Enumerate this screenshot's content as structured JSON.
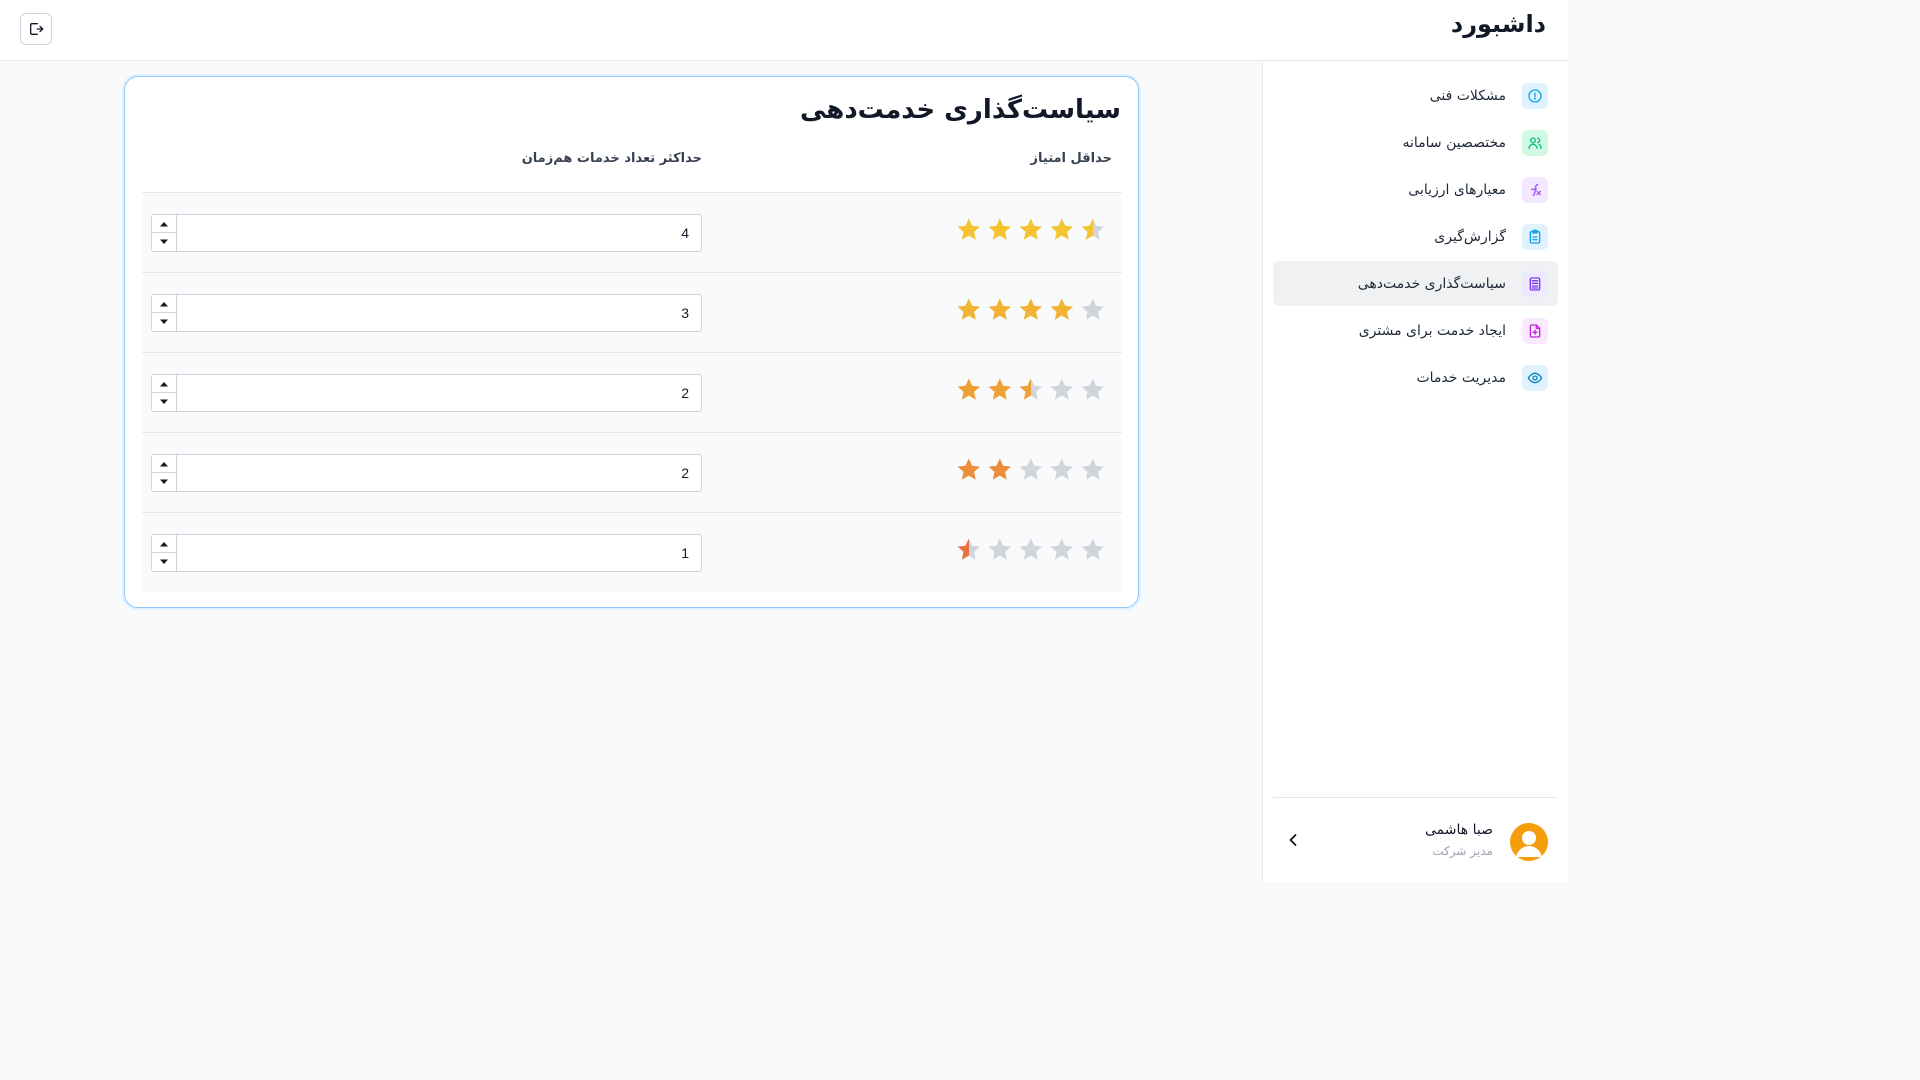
{
  "header": {
    "brand": "داشبورد",
    "logout_icon": "logout-icon"
  },
  "sidebar": {
    "items": [
      {
        "label": "مشکلات فنی",
        "icon": "alert-circle-icon",
        "color": "#0ea5e9",
        "bg": "#e0f2fe",
        "active": false
      },
      {
        "label": "مختصصین سامانه",
        "icon": "users-icon",
        "color": "#10b981",
        "bg": "#d1fae5",
        "active": false
      },
      {
        "label": "معیارهای ارزیابی",
        "icon": "function-icon",
        "color": "#a855f7",
        "bg": "#f3e8ff",
        "active": false
      },
      {
        "label": "گزارش‌گیری",
        "icon": "clipboard-icon",
        "color": "#0ea5e9",
        "bg": "#e0f2fe",
        "active": false
      },
      {
        "label": "سیاست‌گذاری خدمت‌دهی",
        "icon": "calculator-icon",
        "color": "#7c3aed",
        "bg": "#ede9fe",
        "active": true
      },
      {
        "label": "ایجاد خدمت برای مشتری",
        "icon": "file-plus-icon",
        "color": "#c026d3",
        "bg": "#fae8ff",
        "active": false
      },
      {
        "label": "مدیریت خدمات",
        "icon": "eye-icon",
        "color": "#0284c7",
        "bg": "#e0f2fe",
        "active": false
      }
    ],
    "user": {
      "name": "صبا هاشمی",
      "role": "مدیر شرکت"
    }
  },
  "policy": {
    "title": "سیاست‌گذاری خدمت‌دهی",
    "col_rating": "حداقل امتیاز",
    "col_max": "حداکثر تعداد خدمات هم‌زمان",
    "rows": [
      {
        "rating": 4.5,
        "max": "4",
        "color": "#f4c430"
      },
      {
        "rating": 4,
        "max": "3",
        "color": "#f2b234"
      },
      {
        "rating": 2.5,
        "max": "2",
        "color": "#efa035"
      },
      {
        "rating": 2,
        "max": "2",
        "color": "#ec8f3b"
      },
      {
        "rating": 0.5,
        "max": "1",
        "color": "#e8703f"
      }
    ]
  }
}
